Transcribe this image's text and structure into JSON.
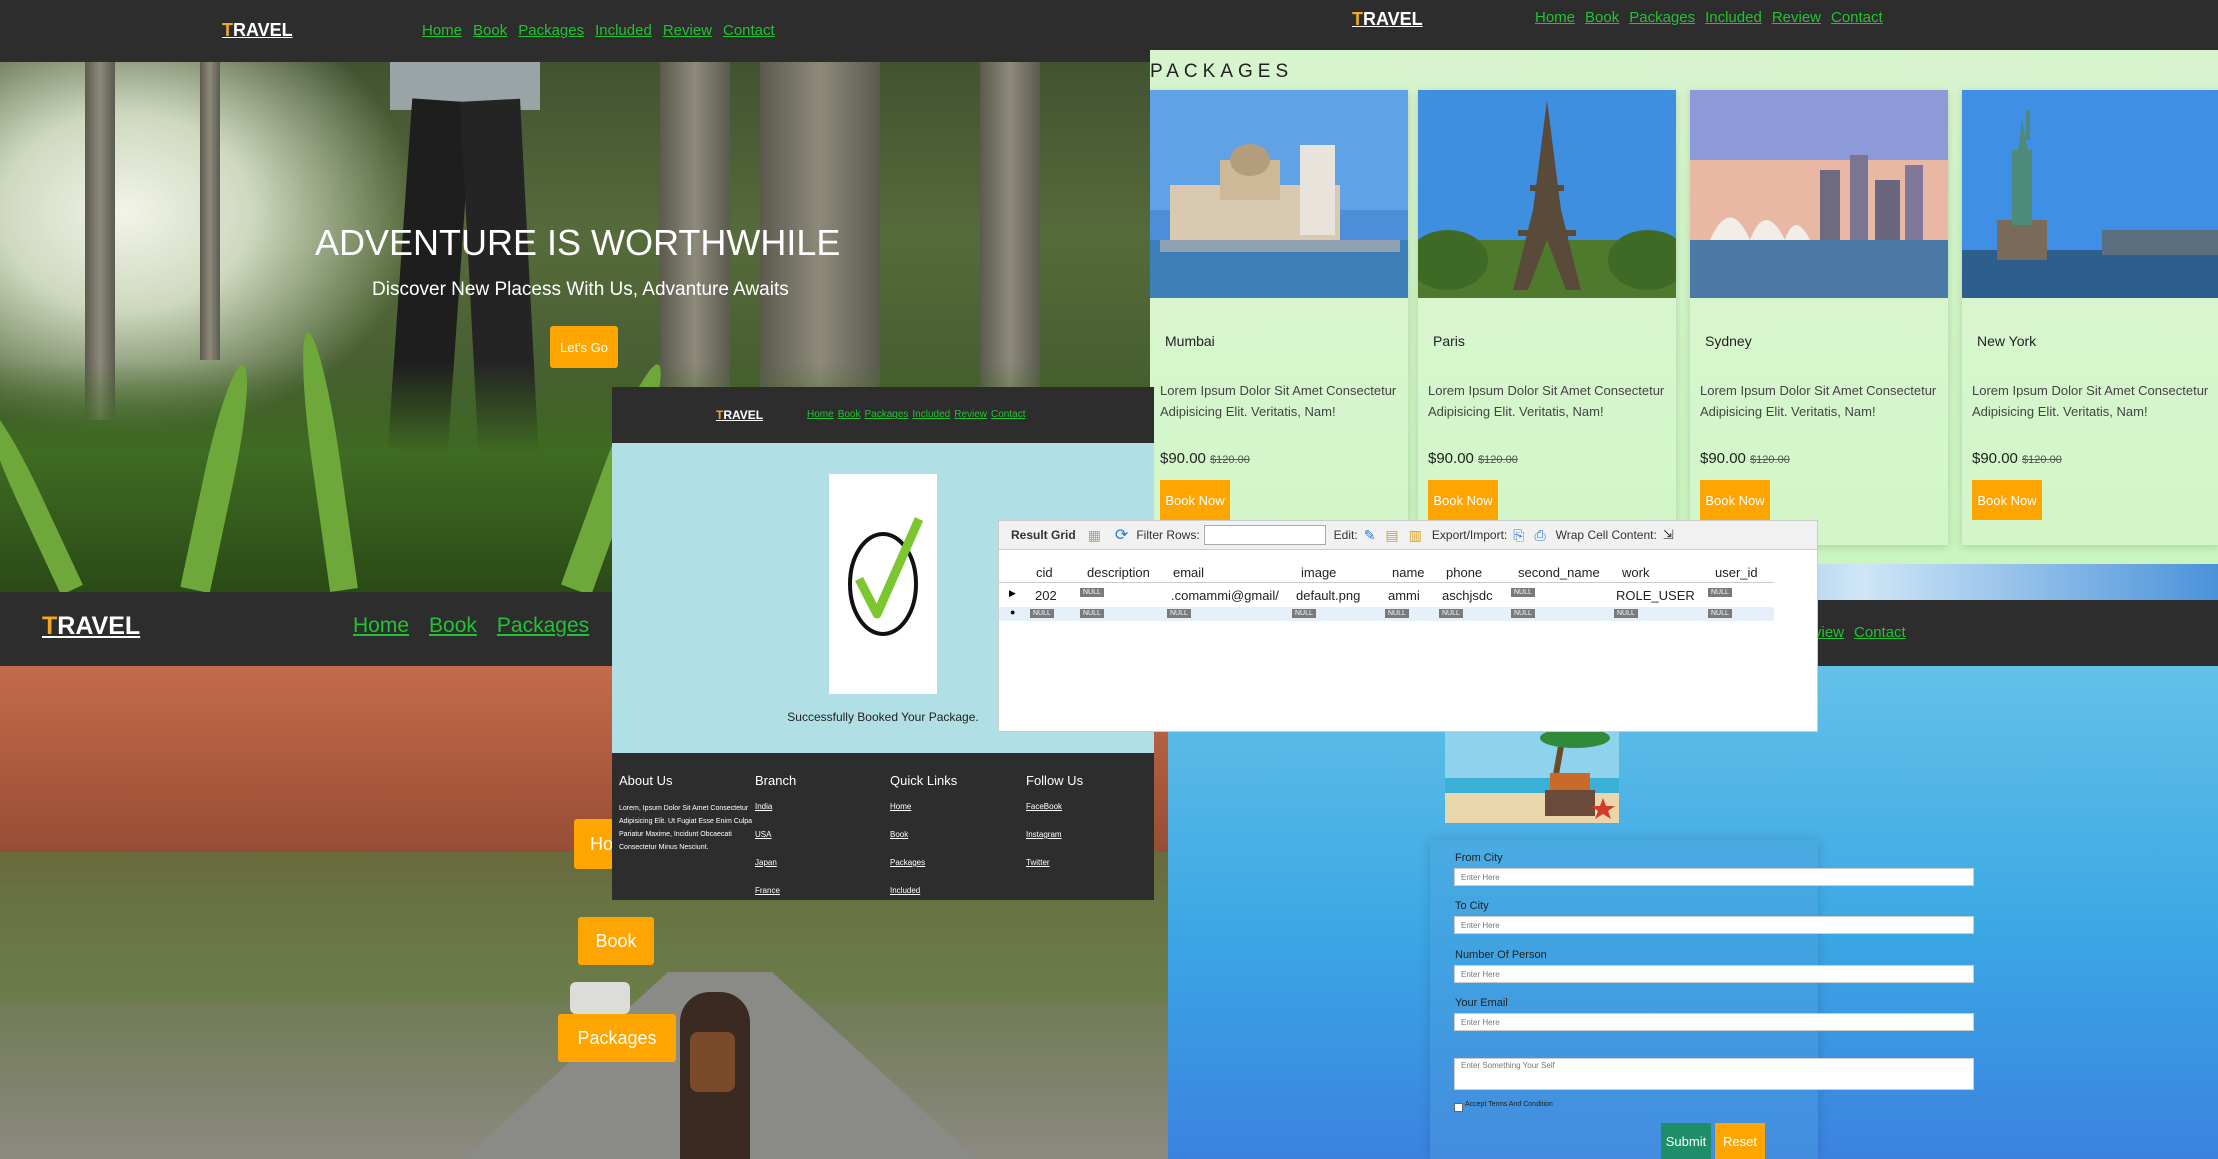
{
  "hero": {
    "logo_t": "T",
    "logo_rest": "RAVEL",
    "nav": [
      "Home",
      "Book",
      "Packages",
      "Included",
      "Review",
      "Contact"
    ],
    "title": "ADVENTURE IS WORTHWHILE",
    "subtitle": "Discover New Placess With Us, Advanture Awaits",
    "cta": "Let's Go"
  },
  "packages": {
    "logo_t": "T",
    "logo_rest": "RAVEL",
    "nav": [
      "Home",
      "Book",
      "Packages",
      "Included",
      "Review",
      "Contact"
    ],
    "heading": "PACKAGES",
    "cards": [
      {
        "city": "Mumbai",
        "desc": "Lorem Ipsum Dolor Sit Amet Consectetur Adipisicing Elit. Veritatis, Nam!",
        "price": "$90.00",
        "old": "$120.00",
        "btn": "Book Now"
      },
      {
        "city": "Paris",
        "desc": "Lorem Ipsum Dolor Sit Amet Consectetur Adipisicing Elit. Veritatis, Nam!",
        "price": "$90.00",
        "old": "$120.00",
        "btn": "Book Now"
      },
      {
        "city": "Sydney",
        "desc": "Lorem Ipsum Dolor Sit Amet Consectetur Adipisicing Elit. Veritatis, Nam!",
        "price": "$90.00",
        "old": "$120.00",
        "btn": "Book Now"
      },
      {
        "city": "New York",
        "desc": "Lorem Ipsum Dolor Sit Amet Consectetur Adipisicing Elit. Veritatis, Nam!",
        "price": "$90.00",
        "old": "$120.00",
        "btn": "Book Now"
      }
    ]
  },
  "road": {
    "logo_t": "T",
    "logo_rest": "RAVEL",
    "nav": [
      "Home",
      "Book",
      "Packages"
    ],
    "btn_home": "Ho",
    "btn_book": "Book",
    "btn_packages": "Packages"
  },
  "booking": {
    "nav_partial": [
      "view",
      "Contact"
    ],
    "fields": [
      {
        "label": "From City",
        "placeholder": "Enter Here"
      },
      {
        "label": "To City",
        "placeholder": "Enter Here"
      },
      {
        "label": "Number Of Person",
        "placeholder": "Enter Here"
      },
      {
        "label": "Your Email",
        "placeholder": "Enter Here"
      }
    ],
    "textarea_placeholder": "Enter Something Your Self",
    "terms": "Accept Terms And Condition",
    "submit": "Submit",
    "reset": "Reset"
  },
  "success": {
    "logo_t": "T",
    "logo_rest": "RAVEL",
    "nav": [
      "Home",
      "Book",
      "Packages",
      "Included",
      "Review",
      "Contact"
    ],
    "message": "Successfully Booked Your Package.",
    "footer": {
      "about_title": "About Us",
      "about_text": "Lorem, Ipsum Dolor Sit Amet Consectetur Adipisicing Elit. Ut Fugiat Esse Enim Culpa Pariatur Maxime, Incidunt Obcaecati Consectetur Minus Nesciunt.",
      "branch_title": "Branch",
      "branches": [
        "India",
        "USA",
        "Japan",
        "France"
      ],
      "links_title": "Quick Links",
      "links": [
        "Home",
        "Book",
        "Packages",
        "Included"
      ],
      "follow_title": "Follow Us",
      "follow": [
        "FaceBook",
        "Instagram",
        "Twitter"
      ]
    }
  },
  "result_grid": {
    "toolbar": {
      "title": "Result Grid",
      "filter": "Filter Rows:",
      "edit": "Edit:",
      "export": "Export/Import:",
      "wrap": "Wrap Cell Content:"
    },
    "columns": [
      "cid",
      "description",
      "email",
      "image",
      "name",
      "phone",
      "second_name",
      "work",
      "user_id"
    ],
    "row": {
      "cid": "202",
      "email": ".comammi@gmail/",
      "image": "default.png",
      "name": "ammi",
      "phone": "aschjsdc",
      "work": "ROLE_USER"
    },
    "null": "NULL"
  }
}
